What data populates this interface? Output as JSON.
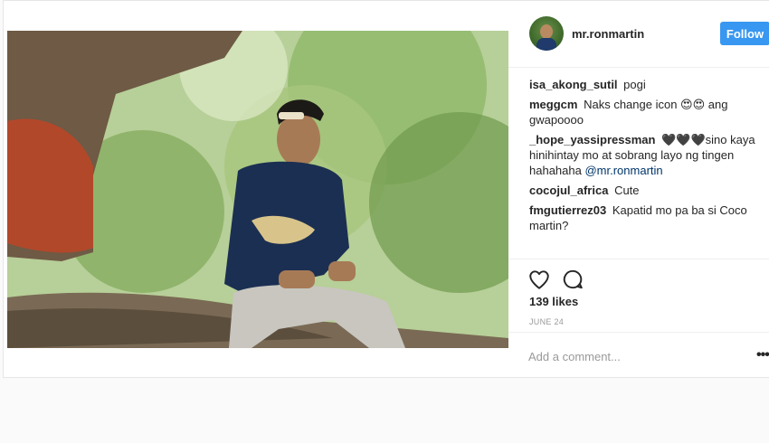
{
  "post": {
    "username": "mr.ronmartin",
    "follow_label": "Follow",
    "likes": "139 likes",
    "date": "JUNE 24",
    "comment_placeholder": "Add a comment...",
    "more_label": "•••"
  },
  "comments": [
    {
      "user": "isa_akong_sutil",
      "text": "pogi"
    },
    {
      "user": "meggcm",
      "text": "Naks change icon 😍😍 ang gwapoooo"
    },
    {
      "user": "_hope_yassipressman",
      "text": "🖤🖤🖤sino kaya hinihintay mo at sobrang layo ng tingen hahahaha",
      "mention": "@mr.ronmartin"
    },
    {
      "user": "cocojul_africa",
      "text": "Cute"
    },
    {
      "user": "fmgutierrez03",
      "text": "Kapatid mo pa ba si Coco martin?"
    }
  ],
  "icons": {
    "like": "heart-icon",
    "comment": "comment-bubble-icon",
    "more": "ellipsis-icon"
  },
  "colors": {
    "accent": "#3897f0",
    "text": "#262626",
    "muted": "#999999"
  }
}
